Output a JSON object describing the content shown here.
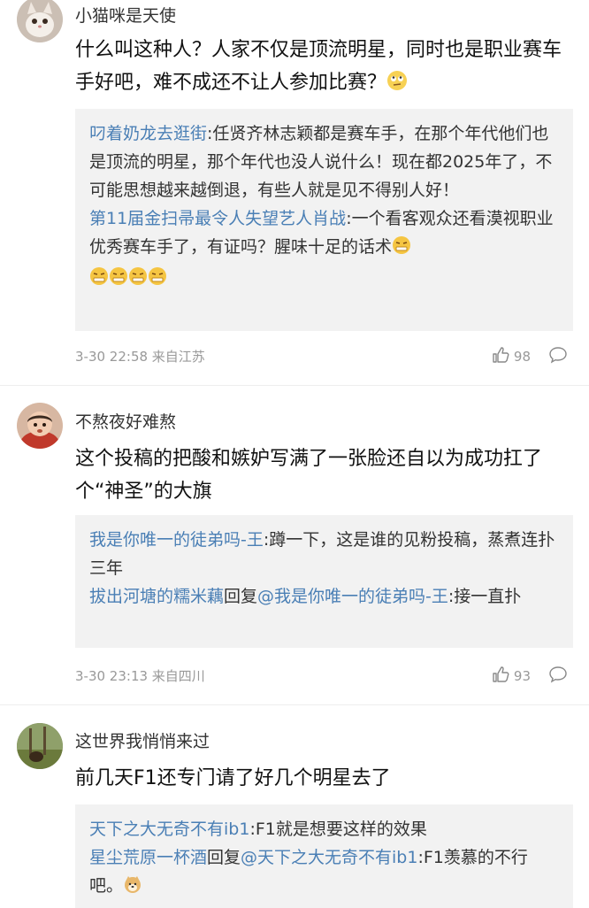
{
  "comments": [
    {
      "username": "小猫咪是天使",
      "content": "什么叫这种人？人家不仅是顶流明星，同时也是职业赛车手好吧，难不成还不让人参加比赛？",
      "content_emoji": "rolling-eyes-emoji",
      "replies": [
        {
          "name": "叼着奶龙去逛街",
          "text": ":任贤齐林志颖都是赛车手，在那个年代他们也是顶流的明星，那个年代也没人说什么！现在都2025年了，不可能思想越来越倒退，有些人就是见不得别人好！"
        },
        {
          "name": "第11届金扫帚最令人失望艺人肖战",
          "text": ":一个看客观众还看漠视职业优秀赛车手了，有证吗？腥味十足的话术"
        }
      ],
      "time": "3-30 22:58 来自江苏",
      "likes": "98"
    },
    {
      "username": "不熬夜好难熬",
      "content": "这个投稿的把酸和嫉妒写满了一张脸还自以为成功扛了个“神圣”的大旗",
      "replies": [
        {
          "name": "我是你唯一的徒弟吗-王",
          "text": ":蹲一下，这是谁的见粉投稿，蒸煮连扑三年"
        },
        {
          "name": "拔出河塘的糯米藕",
          "mid": "回复",
          "mention": "@我是你唯一的徒弟吗-王",
          "text": ":接一直扑"
        }
      ],
      "time": "3-30 23:13 来自四川",
      "likes": "93"
    },
    {
      "username": "这世界我悄悄来过",
      "content": "前几天F1还专门请了好几个明星去了",
      "replies": [
        {
          "name": "天下之大无奇不有ib1",
          "text": ":F1就是想要这样的效果"
        },
        {
          "name": "星尘荒原一杯酒",
          "mid": "回复",
          "mention": "@天下之大无奇不有ib1",
          "text": ":F1羡慕的不行吧。"
        }
      ]
    }
  ],
  "icons": {
    "like": "thumbs-up-icon",
    "comment": "comment-bubble-icon"
  },
  "colors": {
    "link": "#4a7fb5",
    "reply_bg": "#f2f2f2",
    "meta": "#999999"
  }
}
